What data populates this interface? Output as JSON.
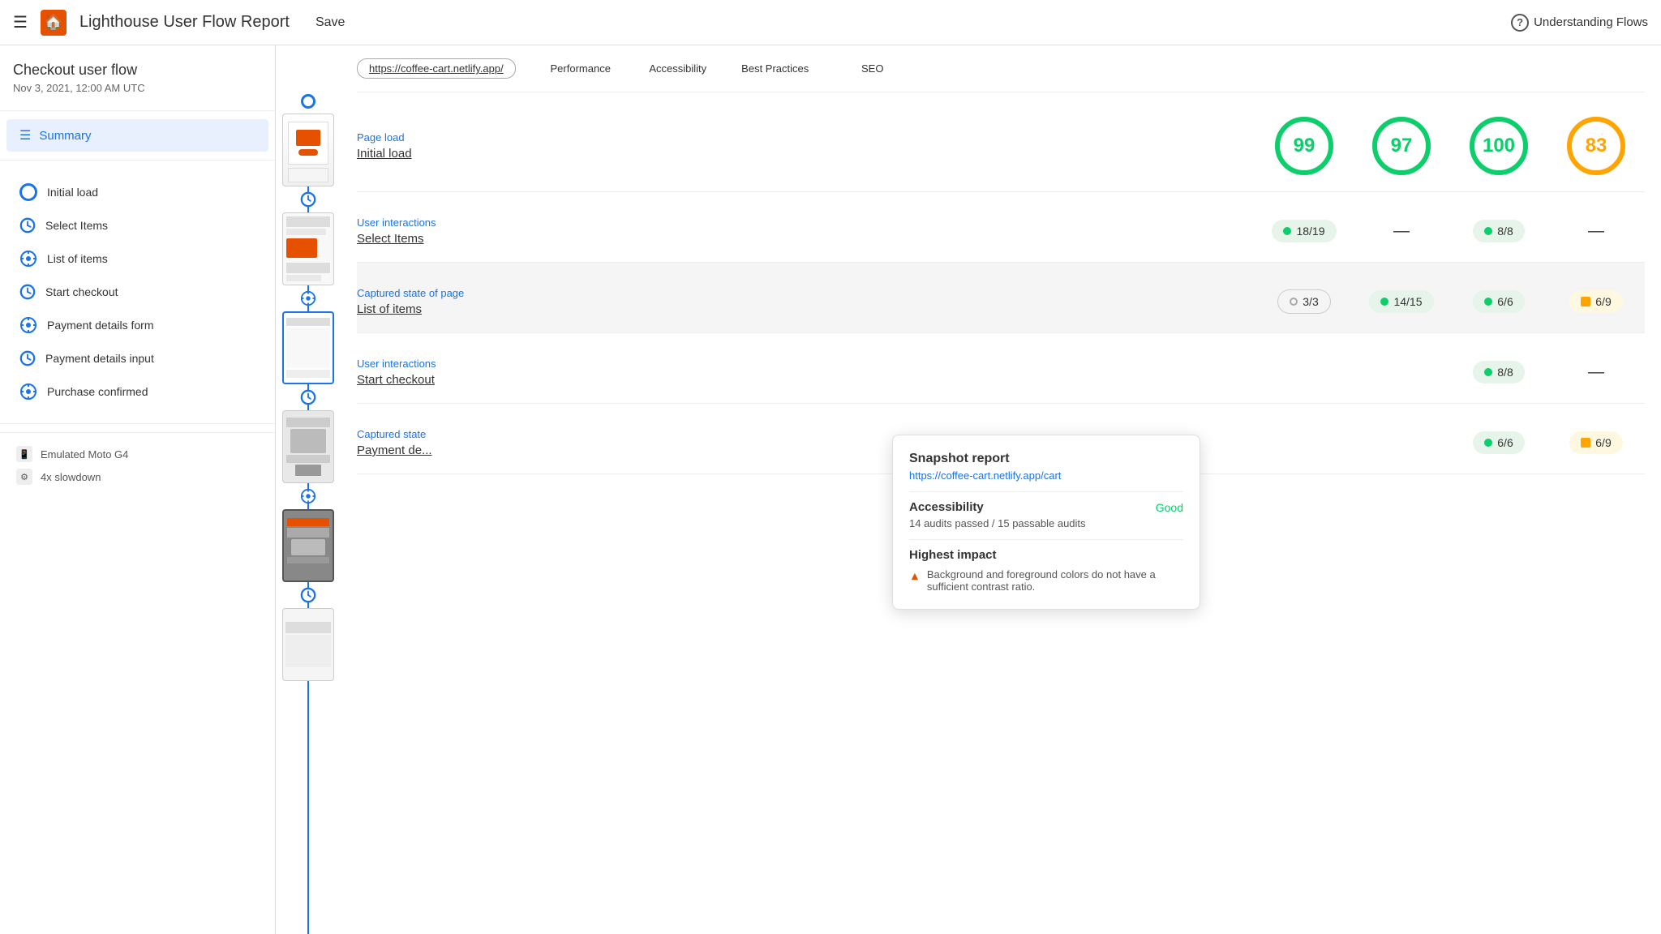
{
  "topNav": {
    "hamburger": "☰",
    "logo": "🏠",
    "title": "Lighthouse User Flow Report",
    "save": "Save",
    "helpIcon": "?",
    "helpText": "Understanding Flows"
  },
  "sidebar": {
    "title": "Checkout user flow",
    "date": "Nov 3, 2021, 12:00 AM UTC",
    "summaryLabel": "Summary",
    "navItems": [
      {
        "icon": "circle",
        "label": "Initial load"
      },
      {
        "icon": "clock",
        "label": "Select Items"
      },
      {
        "icon": "snapshot",
        "label": "List of items"
      },
      {
        "icon": "clock",
        "label": "Start checkout"
      },
      {
        "icon": "snapshot",
        "label": "Payment details form"
      },
      {
        "icon": "clock",
        "label": "Payment details input"
      },
      {
        "icon": "snapshot",
        "label": "Purchase confirmed"
      }
    ],
    "footerItems": [
      {
        "icon": "device",
        "label": "Emulated Moto G4"
      },
      {
        "icon": "slowdown",
        "label": "4x slowdown"
      }
    ]
  },
  "scoresHeader": {
    "url": "https://coffee-cart.netlify.app/",
    "columns": [
      "Performance",
      "Accessibility",
      "Best Practices",
      "SEO"
    ]
  },
  "sections": [
    {
      "type": "Page load",
      "name": "Initial load",
      "scores": [
        {
          "kind": "circle",
          "value": "99",
          "color": "green"
        },
        {
          "kind": "circle",
          "value": "97",
          "color": "green"
        },
        {
          "kind": "circle",
          "value": "100",
          "color": "green"
        },
        {
          "kind": "circle",
          "value": "83",
          "color": "orange"
        }
      ]
    },
    {
      "type": "User interactions",
      "name": "Select Items",
      "scores": [
        {
          "kind": "pill-green",
          "value": "18/19"
        },
        {
          "kind": "dash",
          "value": "—"
        },
        {
          "kind": "pill-green",
          "value": "8/8"
        },
        {
          "kind": "dash",
          "value": "—"
        }
      ]
    },
    {
      "type": "Captured state of page",
      "name": "List of items",
      "scores": [
        {
          "kind": "pill-gray",
          "value": "3/3"
        },
        {
          "kind": "pill-green",
          "value": "14/15"
        },
        {
          "kind": "pill-green",
          "value": "6/6"
        },
        {
          "kind": "pill-orange",
          "value": "6/9"
        }
      ]
    },
    {
      "type": "User interactions",
      "name": "Start checkout",
      "scores": [
        {
          "kind": "dash",
          "value": "—"
        },
        {
          "kind": "dash",
          "value": "—"
        },
        {
          "kind": "pill-green",
          "value": "8/8"
        },
        {
          "kind": "dash",
          "value": "—"
        }
      ]
    },
    {
      "type": "Captured state",
      "name": "Payment de...",
      "scores": [
        {
          "kind": "dash",
          "value": "—"
        },
        {
          "kind": "dash",
          "value": "—"
        },
        {
          "kind": "pill-green",
          "value": "6/6"
        },
        {
          "kind": "pill-orange",
          "value": "6/9"
        }
      ]
    }
  ],
  "tooltip": {
    "title": "Snapshot report",
    "url": "https://coffee-cart.netlify.app/cart",
    "accessibilityLabel": "Accessibility",
    "accessibilityStatus": "Good",
    "accessibilityDesc": "14 audits passed / 15 passable audits",
    "highestImpactLabel": "Highest impact",
    "highestImpactItem": "Background and foreground colors do not have a sufficient contrast ratio."
  },
  "colors": {
    "blue": "#1a73e8",
    "green": "#0cce6b",
    "orange": "#ffa400",
    "red": "#e65100"
  }
}
